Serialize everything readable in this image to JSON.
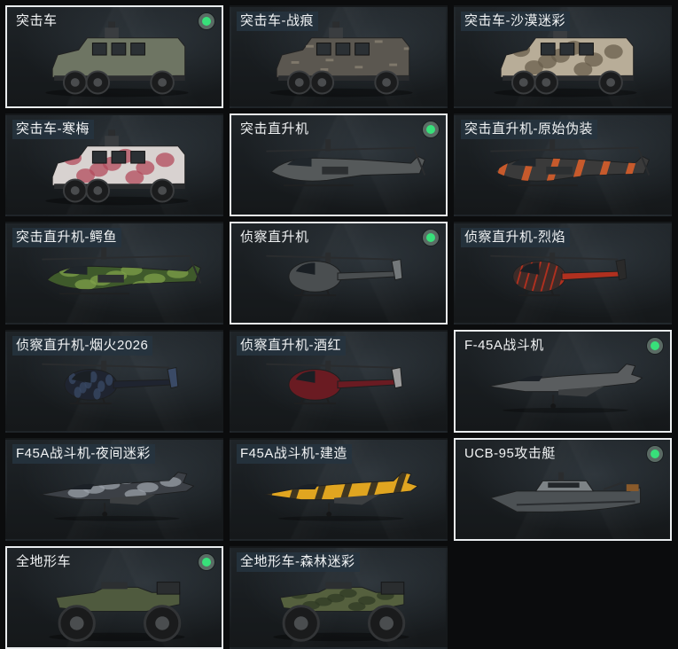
{
  "cards": [
    {
      "label": "突击车",
      "kind": "truck",
      "paint": "#6e7563",
      "accent": "#9aa08d",
      "camo": "none",
      "selected": true,
      "owned": true
    },
    {
      "label": "突击车-战痕",
      "kind": "truck",
      "paint": "#5b5750",
      "accent": "#8e8676",
      "camo": "scar",
      "selected": false,
      "owned": false
    },
    {
      "label": "突击车-沙漠迷彩",
      "kind": "truck",
      "paint": "#b8ad98",
      "accent": "#6a5f4c",
      "camo": "spots",
      "selected": false,
      "owned": false
    },
    {
      "label": "突击车-寒梅",
      "kind": "truck",
      "paint": "#d8d2d0",
      "accent": "#b34b5c",
      "camo": "spots",
      "selected": false,
      "owned": false
    },
    {
      "label": "突击直升机",
      "kind": "attack-heli",
      "paint": "#55595a",
      "accent": "#7c8082",
      "camo": "none",
      "selected": true,
      "owned": true
    },
    {
      "label": "突击直升机-原始伪装",
      "kind": "attack-heli",
      "paint": "#3a3a3a",
      "accent": "#e0602a",
      "camo": "stripes",
      "selected": false,
      "owned": false
    },
    {
      "label": "突击直升机-鳄鱼",
      "kind": "attack-heli",
      "paint": "#3f5a2b",
      "accent": "#7fa04a",
      "camo": "spots",
      "selected": false,
      "owned": false
    },
    {
      "label": "侦察直升机",
      "kind": "scout-heli",
      "paint": "#4a4e50",
      "accent": "#73787a",
      "camo": "none",
      "selected": true,
      "owned": true
    },
    {
      "label": "侦察直升机-烈焰",
      "kind": "scout-heli",
      "paint": "#b0301f",
      "accent": "#2a2a2a",
      "camo": "stripes",
      "selected": false,
      "owned": false
    },
    {
      "label": "侦察直升机-烟火2026",
      "kind": "scout-heli",
      "paint": "#1f2430",
      "accent": "#3a4a66",
      "camo": "spots",
      "selected": false,
      "owned": false
    },
    {
      "label": "侦察直升机-酒红",
      "kind": "scout-heli",
      "paint": "#6a1b22",
      "accent": "#9c9c9c",
      "camo": "none",
      "selected": false,
      "owned": false
    },
    {
      "label": "F-45A战斗机",
      "kind": "jet",
      "paint": "#5a5d5f",
      "accent": "#8a8e90",
      "camo": "none",
      "selected": true,
      "owned": true
    },
    {
      "label": "F45A战斗机-夜间迷彩",
      "kind": "jet",
      "paint": "#3c4046",
      "accent": "#9aa0a8",
      "camo": "spots",
      "selected": false,
      "owned": false
    },
    {
      "label": "F45A战斗机-建造",
      "kind": "jet",
      "paint": "#e0a520",
      "accent": "#222222",
      "camo": "stripes",
      "selected": false,
      "owned": false
    },
    {
      "label": "UCB-95攻击艇",
      "kind": "boat",
      "paint": "#4c5154",
      "accent": "#7d8386",
      "camo": "none",
      "selected": true,
      "owned": true
    },
    {
      "label": "全地形车",
      "kind": "atv",
      "paint": "#4f5a3e",
      "accent": "#6e7a58",
      "camo": "none",
      "selected": true,
      "owned": true
    },
    {
      "label": "全地形车-森林迷彩",
      "kind": "atv",
      "paint": "#55603e",
      "accent": "#2f3a24",
      "camo": "spots",
      "selected": false,
      "owned": false
    }
  ]
}
